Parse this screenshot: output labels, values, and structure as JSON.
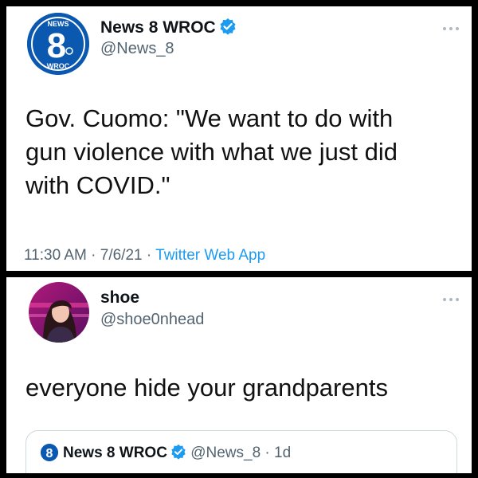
{
  "tweet_top": {
    "avatar": {
      "icon": "news8-wroc-logo-icon",
      "logo_top": "NEWS",
      "logo_num": "8",
      "logo_bottom": "WROC",
      "color": "#0b58b0"
    },
    "display_name": "News 8 WROC",
    "handle": "@News_8",
    "verified": true,
    "text_lines": [
      "Gov. Cuomo: \"We want to do with",
      "gun violence with what we just did",
      "with COVID.\""
    ],
    "time": "11:30 AM",
    "date": "7/6/21",
    "source": "Twitter Web App",
    "separator": "·"
  },
  "tweet_bottom": {
    "avatar": {
      "icon": "profile-photo-avatar"
    },
    "display_name": "shoe",
    "handle": "@shoe0nhead",
    "text": "everyone hide your grandparents",
    "quote": {
      "display_name": "News 8 WROC",
      "handle": "@News_8",
      "separator": "·",
      "age": "1d",
      "logo_num": "8"
    }
  },
  "colors": {
    "link": "#1d9bf0",
    "muted": "#536471",
    "verified": "#1d9bf0",
    "brand": "#0b58b0"
  }
}
